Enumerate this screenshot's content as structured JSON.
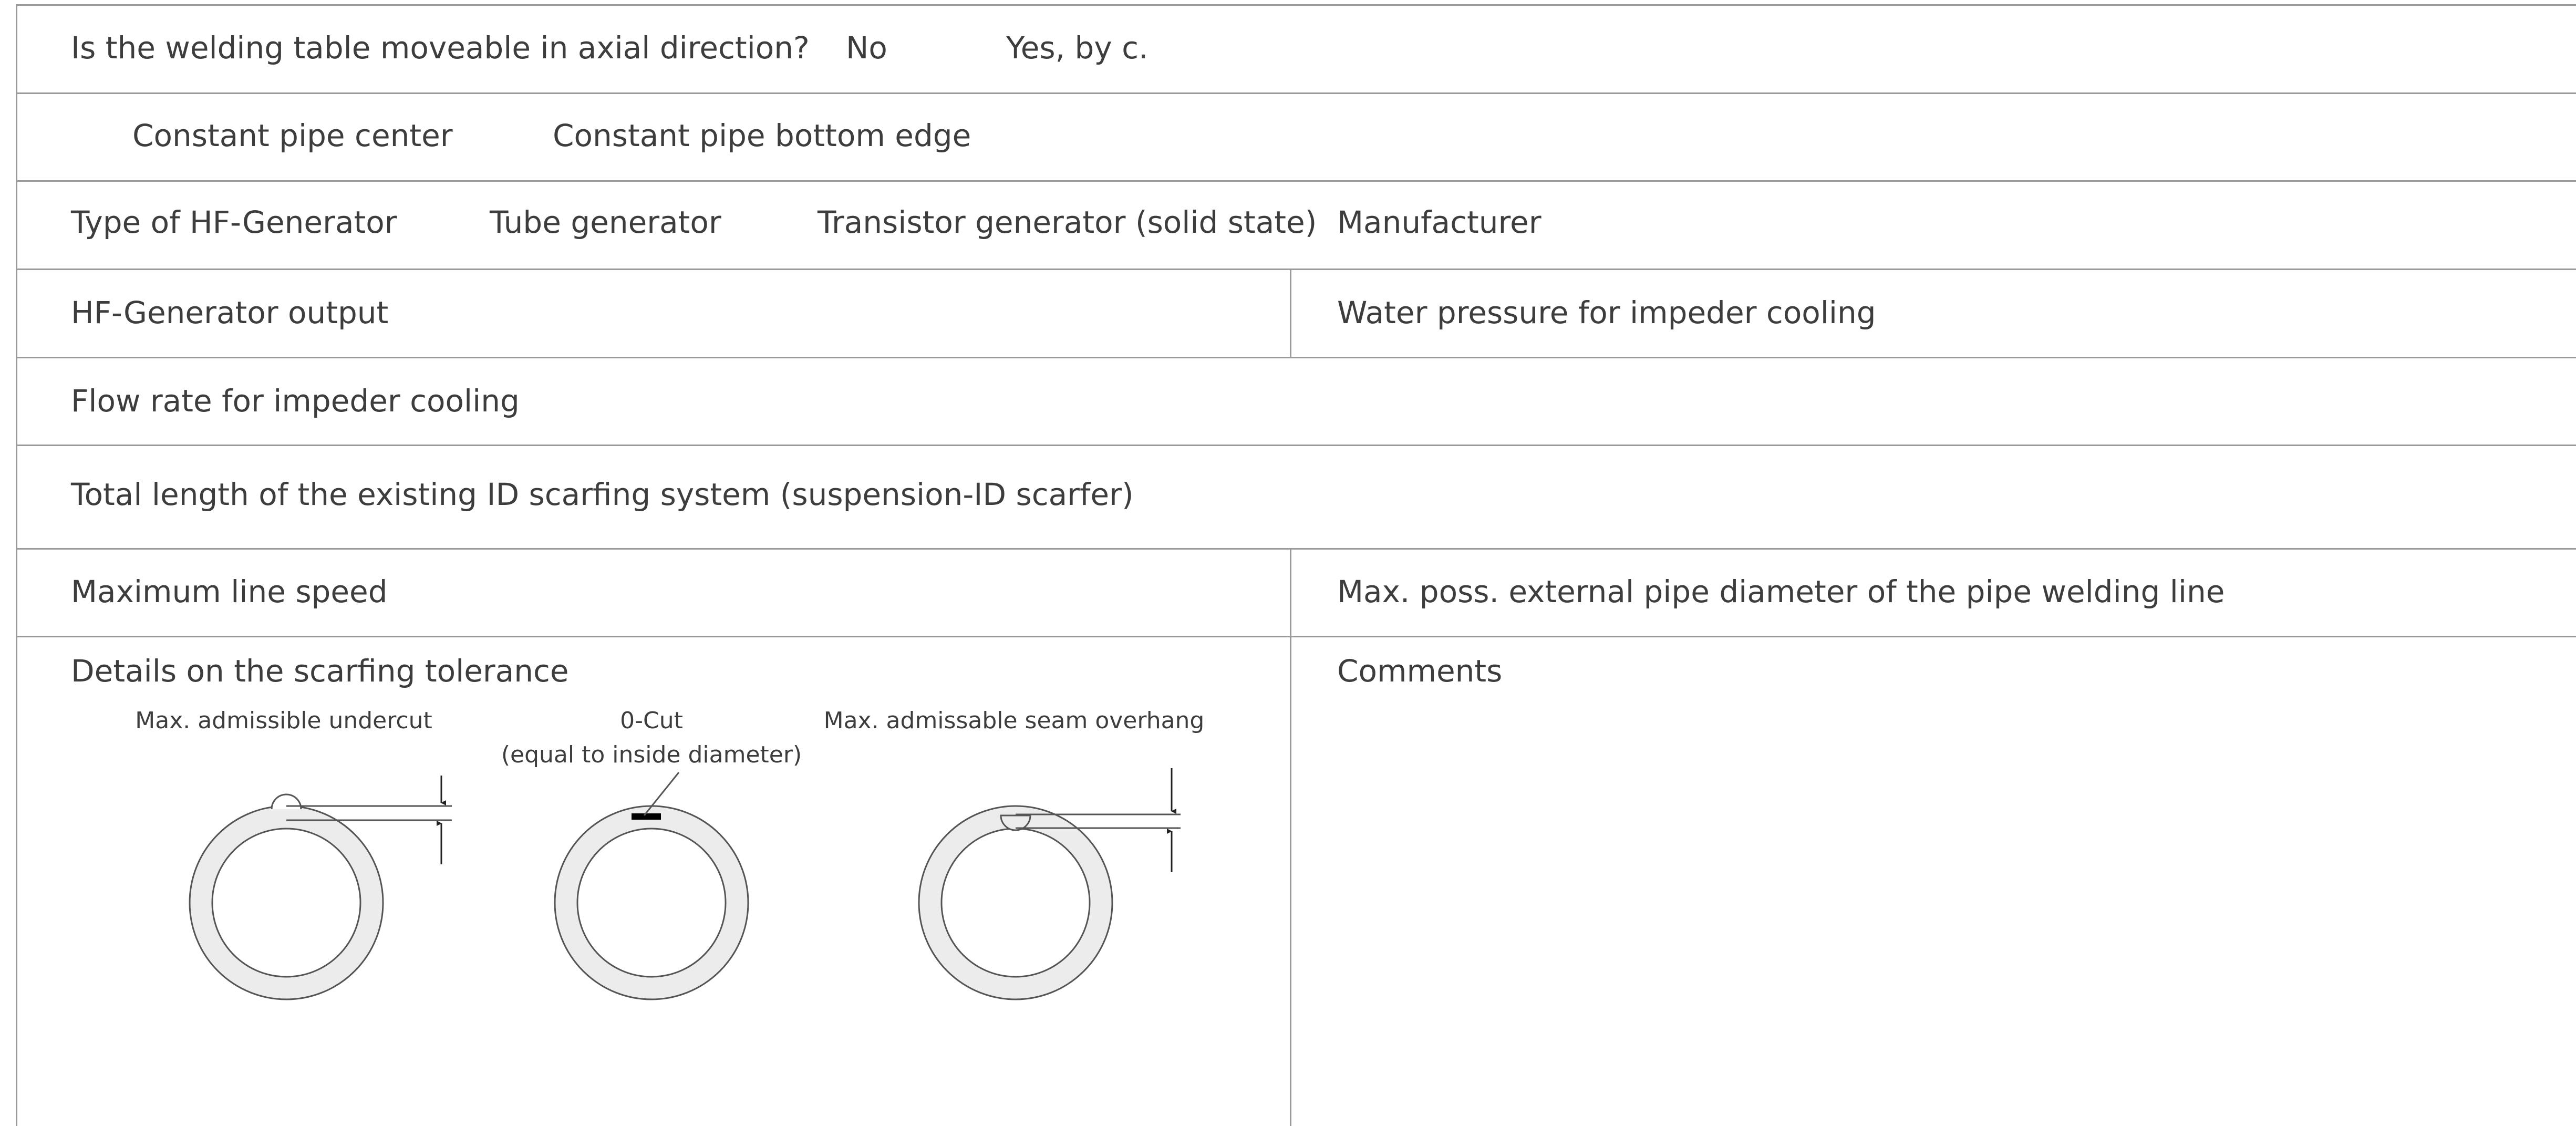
{
  "rows": {
    "welding_table": {
      "question": "Is the welding table moveable in axial direction?",
      "option_no": "No",
      "option_yes": "Yes, by c."
    },
    "pipe_reference": {
      "option_center": "Constant pipe center",
      "option_bottom": "Constant pipe bottom edge"
    },
    "generator_type": {
      "label": "Type of HF-Generator",
      "option_tube": "Tube generator",
      "option_transistor": "Transistor generator (solid state)",
      "manufacturer_label": "Manufacturer"
    },
    "generator_output": {
      "label": "HF-Generator output",
      "water_pressure_label": "Water pressure for impeder cooling"
    },
    "flow_rate": {
      "label": "Flow rate for impeder cooling"
    },
    "scarfing_length": {
      "label": "Total length of the existing ID scarfing system (suspension-ID scarfer)"
    },
    "line_speed": {
      "label": "Maximum line speed",
      "max_diameter_label": "Max. poss. external pipe diameter of the pipe welding line"
    },
    "scarfing_tolerance": {
      "label": "Details on the scarfing tolerance",
      "comments_label": "Comments",
      "diagram_undercut": "Max. admissible undercut",
      "diagram_zero_cut_line1": "0-Cut",
      "diagram_zero_cut_line2": "(equal to inside diameter)",
      "diagram_overhang": "Max. admissable seam overhang"
    }
  },
  "colors": {
    "text": "#3d3d3d",
    "rule": "#9a9a9a",
    "pipe_fill": "#ececec",
    "pipe_stroke": "#555555"
  }
}
